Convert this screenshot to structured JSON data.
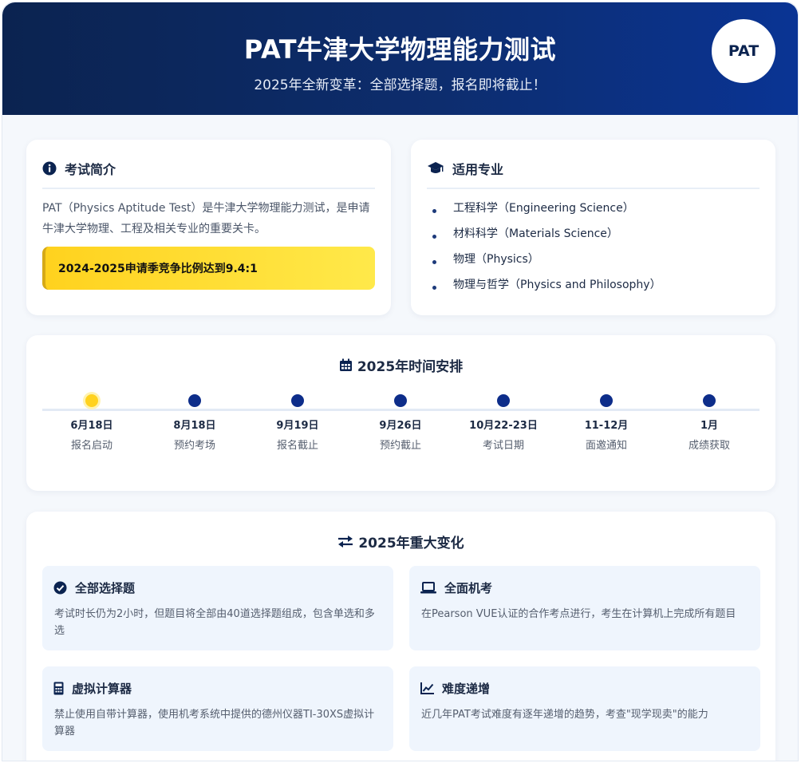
{
  "header": {
    "title": "PAT牛津大学物理能力测试",
    "subtitle": "2025年全新变革：全部选择题，报名即将截止！",
    "logo": "PAT"
  },
  "intro": {
    "icon": "info-circle-icon",
    "title": "考试简介",
    "text": "PAT（Physics Aptitude Test）是牛津大学物理能力测试，是申请牛津大学物理、工程及相关专业的重要关卡。",
    "highlight": "2024-2025申请季竞争比例达到9.4:1"
  },
  "majors": {
    "icon": "graduation-cap-icon",
    "title": "适用专业",
    "items": [
      "工程科学（Engineering Science）",
      "材料科学（Materials Science）",
      "物理（Physics）",
      "物理与哲学（Physics and Philosophy）"
    ]
  },
  "timeline": {
    "icon": "calendar-icon",
    "title": "2025年时间安排",
    "items": [
      {
        "date": "6月18日",
        "label": "报名启动",
        "active": true
      },
      {
        "date": "8月18日",
        "label": "预约考场",
        "active": false
      },
      {
        "date": "9月19日",
        "label": "报名截止",
        "active": false
      },
      {
        "date": "9月26日",
        "label": "预约截止",
        "active": false
      },
      {
        "date": "10月22-23日",
        "label": "考试日期",
        "active": false
      },
      {
        "date": "11-12月",
        "label": "面邀通知",
        "active": false
      },
      {
        "date": "1月",
        "label": "成绩获取",
        "active": false
      }
    ]
  },
  "changes": {
    "icon": "exchange-arrows-icon",
    "title": "2025年重大变化",
    "items": [
      {
        "icon": "check-circle-icon",
        "title": "全部选择题",
        "desc": "考试时长仍为2小时，但题目将全部由40道选择题组成，包含单选和多选"
      },
      {
        "icon": "laptop-icon",
        "title": "全面机考",
        "desc": "在Pearson VUE认证的合作考点进行，考生在计算机上完成所有题目"
      },
      {
        "icon": "calculator-icon",
        "title": "虚拟计算器",
        "desc": "禁止使用自带计算器，使用机考系统中提供的德州仪器TI-30XS虚拟计算器"
      },
      {
        "icon": "line-chart-icon",
        "title": "难度递增",
        "desc": "近几年PAT考试难度有逐年递增的趋势，考查\"现学现卖\"的能力"
      }
    ]
  },
  "colors": {
    "header_start": "#0b2350",
    "header_end": "#0a3494",
    "accent_yellow": "#ffd21e",
    "dot_blue": "#0d2d8a",
    "change_bg": "#eff5fd"
  }
}
